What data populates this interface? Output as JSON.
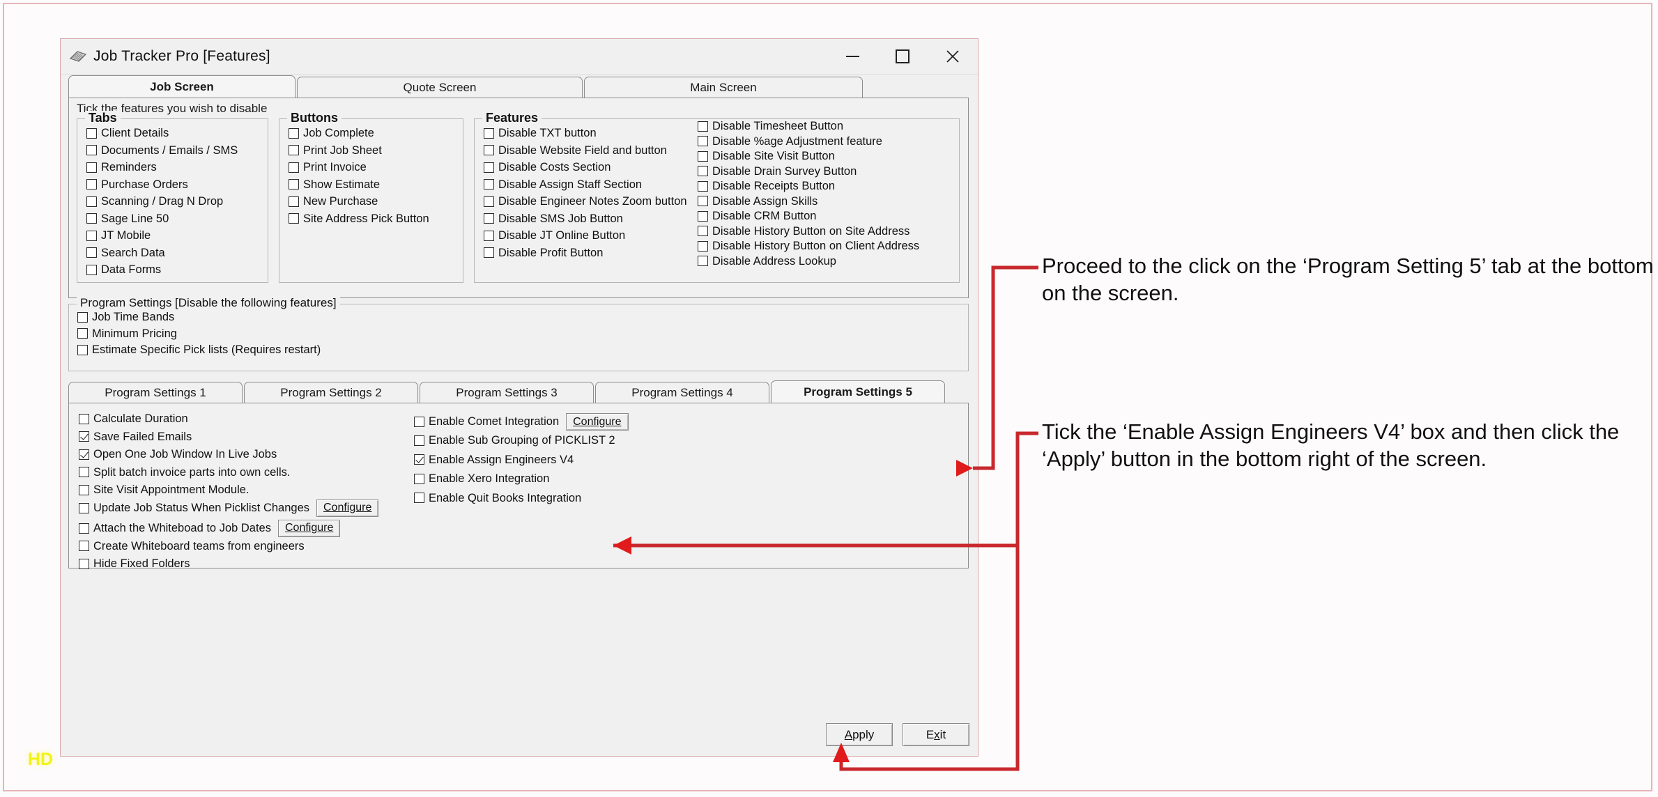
{
  "window": {
    "title": "Job Tracker Pro [Features]",
    "icon": "app-icon",
    "controls": {
      "minimize": "minimize-icon",
      "maximize": "maximize-icon",
      "close": "close-icon"
    }
  },
  "top_tabs": [
    {
      "label": "Job Screen",
      "selected": true
    },
    {
      "label": "Quote Screen",
      "selected": false
    },
    {
      "label": "Main Screen",
      "selected": false
    }
  ],
  "job_screen": {
    "hint": "Tick the features you wish to disable",
    "groups": [
      {
        "title": "Tabs",
        "items": [
          {
            "label": "Client Details",
            "checked": false
          },
          {
            "label": "Documents / Emails / SMS",
            "checked": false
          },
          {
            "label": "Reminders",
            "checked": false
          },
          {
            "label": "Purchase Orders",
            "checked": false
          },
          {
            "label": "Scanning / Drag N Drop",
            "checked": false
          },
          {
            "label": "Sage Line 50",
            "checked": false
          },
          {
            "label": "JT Mobile",
            "checked": false
          },
          {
            "label": "Search Data",
            "checked": false
          },
          {
            "label": "Data Forms",
            "checked": false
          }
        ]
      },
      {
        "title": "Buttons",
        "items": [
          {
            "label": "Job Complete",
            "checked": false
          },
          {
            "label": "Print Job Sheet",
            "checked": false
          },
          {
            "label": "Print Invoice",
            "checked": false
          },
          {
            "label": "Show Estimate",
            "checked": false
          },
          {
            "label": "New Purchase",
            "checked": false
          },
          {
            "label": "Site Address Pick Button",
            "checked": false
          }
        ]
      },
      {
        "title": "Features",
        "items": [
          {
            "label": "Disable TXT button",
            "checked": false
          },
          {
            "label": "Disable Website Field and button",
            "checked": false
          },
          {
            "label": "Disable Costs Section",
            "checked": false
          },
          {
            "label": "Disable Assign Staff Section",
            "checked": false
          },
          {
            "label": "Disable Engineer Notes Zoom button",
            "checked": false
          },
          {
            "label": "Disable SMS Job Button",
            "checked": false
          },
          {
            "label": "Disable JT Online Button",
            "checked": false
          },
          {
            "label": "Disable Profit Button",
            "checked": false
          }
        ],
        "items_right": [
          {
            "label": "Disable Timesheet Button",
            "checked": false
          },
          {
            "label": "Disable %age Adjustment feature",
            "checked": false
          },
          {
            "label": "Disable Site Visit Button",
            "checked": false
          },
          {
            "label": "Disable Drain Survey Button",
            "checked": false
          },
          {
            "label": "Disable Receipts Button",
            "checked": false
          },
          {
            "label": "Disable Assign Skills",
            "checked": false
          },
          {
            "label": "Disable CRM Button",
            "checked": false
          },
          {
            "label": "Disable History Button on Site Address",
            "checked": false
          },
          {
            "label": "Disable History Button on Client Address",
            "checked": false
          },
          {
            "label": "Disable Address Lookup",
            "checked": false
          }
        ]
      }
    ]
  },
  "program_settings_group": {
    "title": "Program Settings [Disable the following features]",
    "items": [
      {
        "label": "Job Time Bands",
        "checked": false
      },
      {
        "label": "Minimum Pricing",
        "checked": false
      },
      {
        "label": "Estimate Specific Pick lists (Requires restart)",
        "checked": false
      }
    ]
  },
  "settings_tabs": [
    {
      "label": "Program Settings 1",
      "selected": false
    },
    {
      "label": "Program Settings 2",
      "selected": false
    },
    {
      "label": "Program Settings 3",
      "selected": false
    },
    {
      "label": "Program Settings 4",
      "selected": false
    },
    {
      "label": "Program Settings 5",
      "selected": true
    }
  ],
  "settings_panel": {
    "left_items": [
      {
        "label": "Calculate Duration",
        "checked": false,
        "button": null
      },
      {
        "label": "Save Failed Emails",
        "checked": true,
        "button": null
      },
      {
        "label": "Open One Job Window In Live Jobs",
        "checked": true,
        "button": null
      },
      {
        "label": "Split batch invoice parts into own cells.",
        "checked": false,
        "button": null
      },
      {
        "label": "Site Visit Appointment Module.",
        "checked": false,
        "button": null
      },
      {
        "label": "Update Job Status When Picklist Changes",
        "checked": false,
        "button": "Configure"
      },
      {
        "label": "Attach the Whiteboad to Job Dates",
        "checked": false,
        "button": "Configure"
      },
      {
        "label": "Create Whiteboard teams from engineers",
        "checked": false,
        "button": null
      },
      {
        "label": "Hide Fixed Folders",
        "checked": false,
        "button": null
      }
    ],
    "right_items": [
      {
        "label": "Enable Comet Integration",
        "checked": false,
        "button": "Configure"
      },
      {
        "label": "Enable Sub Grouping of  PICKLIST 2",
        "checked": false,
        "button": null
      },
      {
        "label": "Enable Assign Engineers V4",
        "checked": true,
        "button": null
      },
      {
        "label": "Enable Xero Integration",
        "checked": false,
        "button": null
      },
      {
        "label": "Enable Quit Books Integration",
        "checked": false,
        "button": null
      }
    ]
  },
  "actions": {
    "apply": "Apply",
    "exit": "Exit"
  },
  "annotations": {
    "first": "Proceed to the click on the ‘Program Setting 5’ tab at the bottom on the screen.",
    "second": "Tick the ‘Enable Assign Engineers V4’  box and then click the ‘Apply’ button in the bottom right of the screen."
  },
  "watermark": "HD",
  "colors": {
    "annotation_line": "#c8282d",
    "arrow": "#e01b1b",
    "watermark": "#f2f21a"
  }
}
